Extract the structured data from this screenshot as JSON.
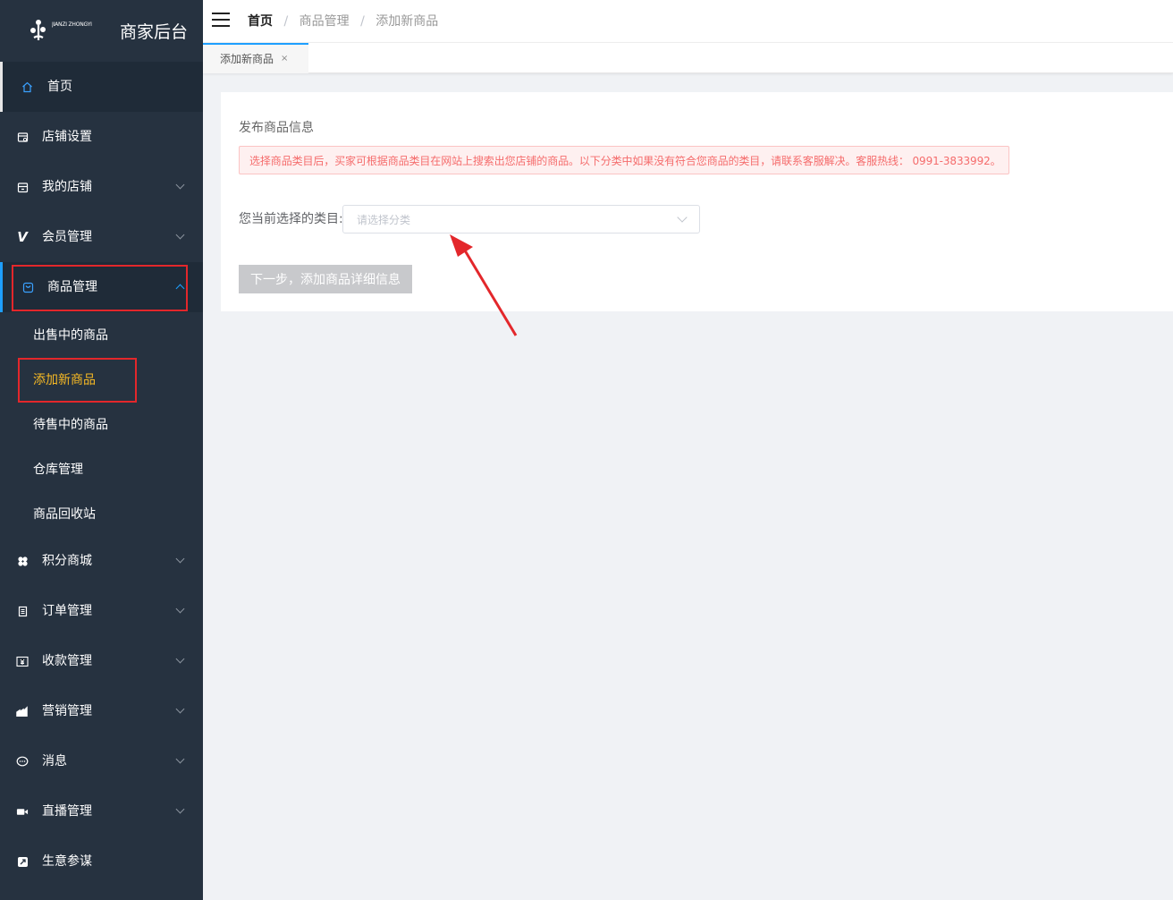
{
  "sidebar": {
    "logo_sub": "JIANZI ZHONGYI",
    "title": "商家后台",
    "items": [
      {
        "label": "首页",
        "icon": "home-icon"
      },
      {
        "label": "店铺设置",
        "icon": "store-settings-icon"
      },
      {
        "label": "我的店铺",
        "icon": "store-icon"
      },
      {
        "label": "会员管理",
        "icon": "vip-icon"
      },
      {
        "label": "商品管理",
        "icon": "bag-icon"
      },
      {
        "label": "积分商城",
        "icon": "points-icon"
      },
      {
        "label": "订单管理",
        "icon": "order-icon"
      },
      {
        "label": "收款管理",
        "icon": "yuan-icon"
      },
      {
        "label": "营销管理",
        "icon": "marketing-icon"
      },
      {
        "label": "消息",
        "icon": "message-icon"
      },
      {
        "label": "直播管理",
        "icon": "video-icon"
      },
      {
        "label": "生意参谋",
        "icon": "analytics-icon"
      }
    ],
    "sub_items": [
      {
        "label": "出售中的商品"
      },
      {
        "label": "添加新商品"
      },
      {
        "label": "待售中的商品"
      },
      {
        "label": "仓库管理"
      },
      {
        "label": "商品回收站"
      }
    ]
  },
  "header": {
    "breadcrumb": [
      "首页",
      "商品管理",
      "添加新商品"
    ]
  },
  "tabs": [
    {
      "label": "添加新商品",
      "close": "×"
    }
  ],
  "main": {
    "section_title": "发布商品信息",
    "notice": "选择商品类目后，买家可根据商品类目在网站上搜索出您店铺的商品。以下分类中如果没有符合您商品的类目，请联系客服解决。客服热线： 0991-3833992。",
    "category_label": "您当前选择的类目:",
    "category_placeholder": "请选择分类",
    "next_button": "下一步，添加商品详细信息"
  },
  "colors": {
    "sidebar_bg": "#263240",
    "accent": "#1e9fff",
    "active_sub": "#f7b924",
    "annotation": "#e3272b"
  }
}
